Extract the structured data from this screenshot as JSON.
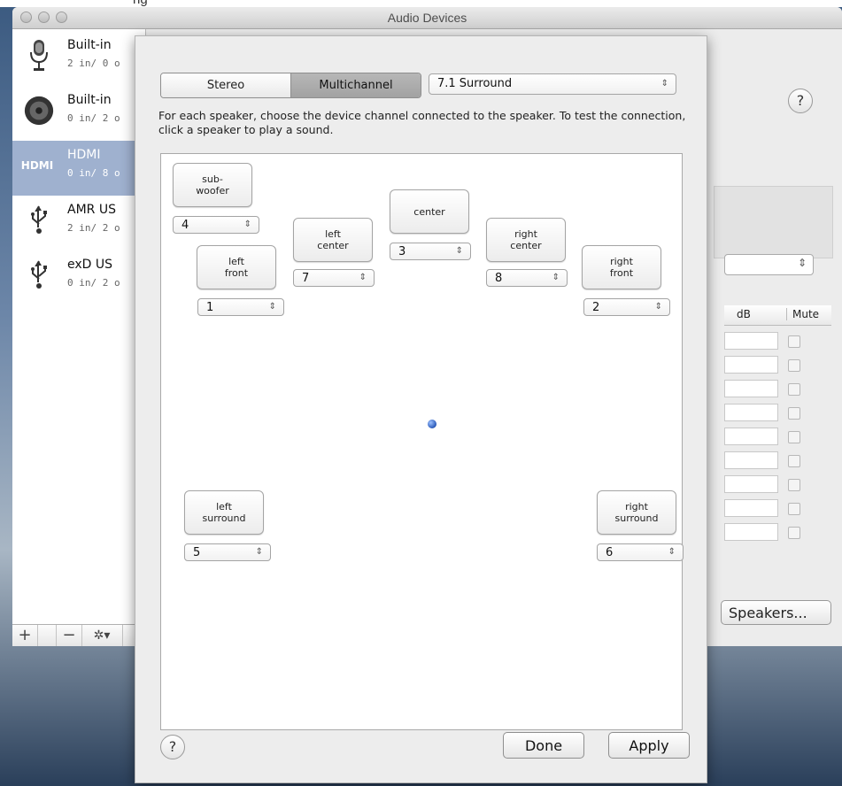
{
  "window": {
    "title": "Audio Devices"
  },
  "sidebar": {
    "devices": [
      {
        "name": "Built-in",
        "channels": "2 in/ 0 o",
        "icon": "microphone-icon"
      },
      {
        "name": "Built-in",
        "channels": "0 in/ 2 o",
        "icon": "speaker-icon"
      },
      {
        "name": "HDMI",
        "channels": "0 in/ 8 o",
        "icon": "hdmi-icon",
        "icon_text": "HDMI"
      },
      {
        "name": "AMR US",
        "channels": "2 in/ 2 o",
        "icon": "usb-icon"
      },
      {
        "name": "exD US",
        "channels": "0 in/ 2 o",
        "icon": "usb-icon"
      }
    ],
    "toolbar": {
      "add": "+",
      "remove": "−",
      "gear": "✲▾"
    }
  },
  "main": {
    "help": "?",
    "table": {
      "db_header": "dB",
      "mute_header": "Mute"
    },
    "configure_speakers_label": "Speakers..."
  },
  "sheet": {
    "segmented": {
      "stereo": "Stereo",
      "multichannel": "Multichannel"
    },
    "layout_popup": {
      "value": "7.1 Surround"
    },
    "instructions": "For each speaker, choose the device channel connected to the speaker. To test the connection, click a speaker to play a sound.",
    "speakers": {
      "subwoofer": {
        "label": "sub-\nwoofer",
        "channel": "4"
      },
      "left_front": {
        "label": "left\nfront",
        "channel": "1"
      },
      "left_center": {
        "label": "left\ncenter",
        "channel": "7"
      },
      "center": {
        "label": "center",
        "channel": "3"
      },
      "right_center": {
        "label": "right\ncenter",
        "channel": "8"
      },
      "right_front": {
        "label": "right\nfront",
        "channel": "2"
      },
      "left_surround": {
        "label": "left\nsurround",
        "channel": "5"
      },
      "right_surround": {
        "label": "right\nsurround",
        "channel": "6"
      }
    },
    "help": "?",
    "done_label": "Done",
    "apply_label": "Apply"
  },
  "colors": {
    "selection": "#9fb1cf",
    "segment_selected": "#a8a8a8"
  }
}
